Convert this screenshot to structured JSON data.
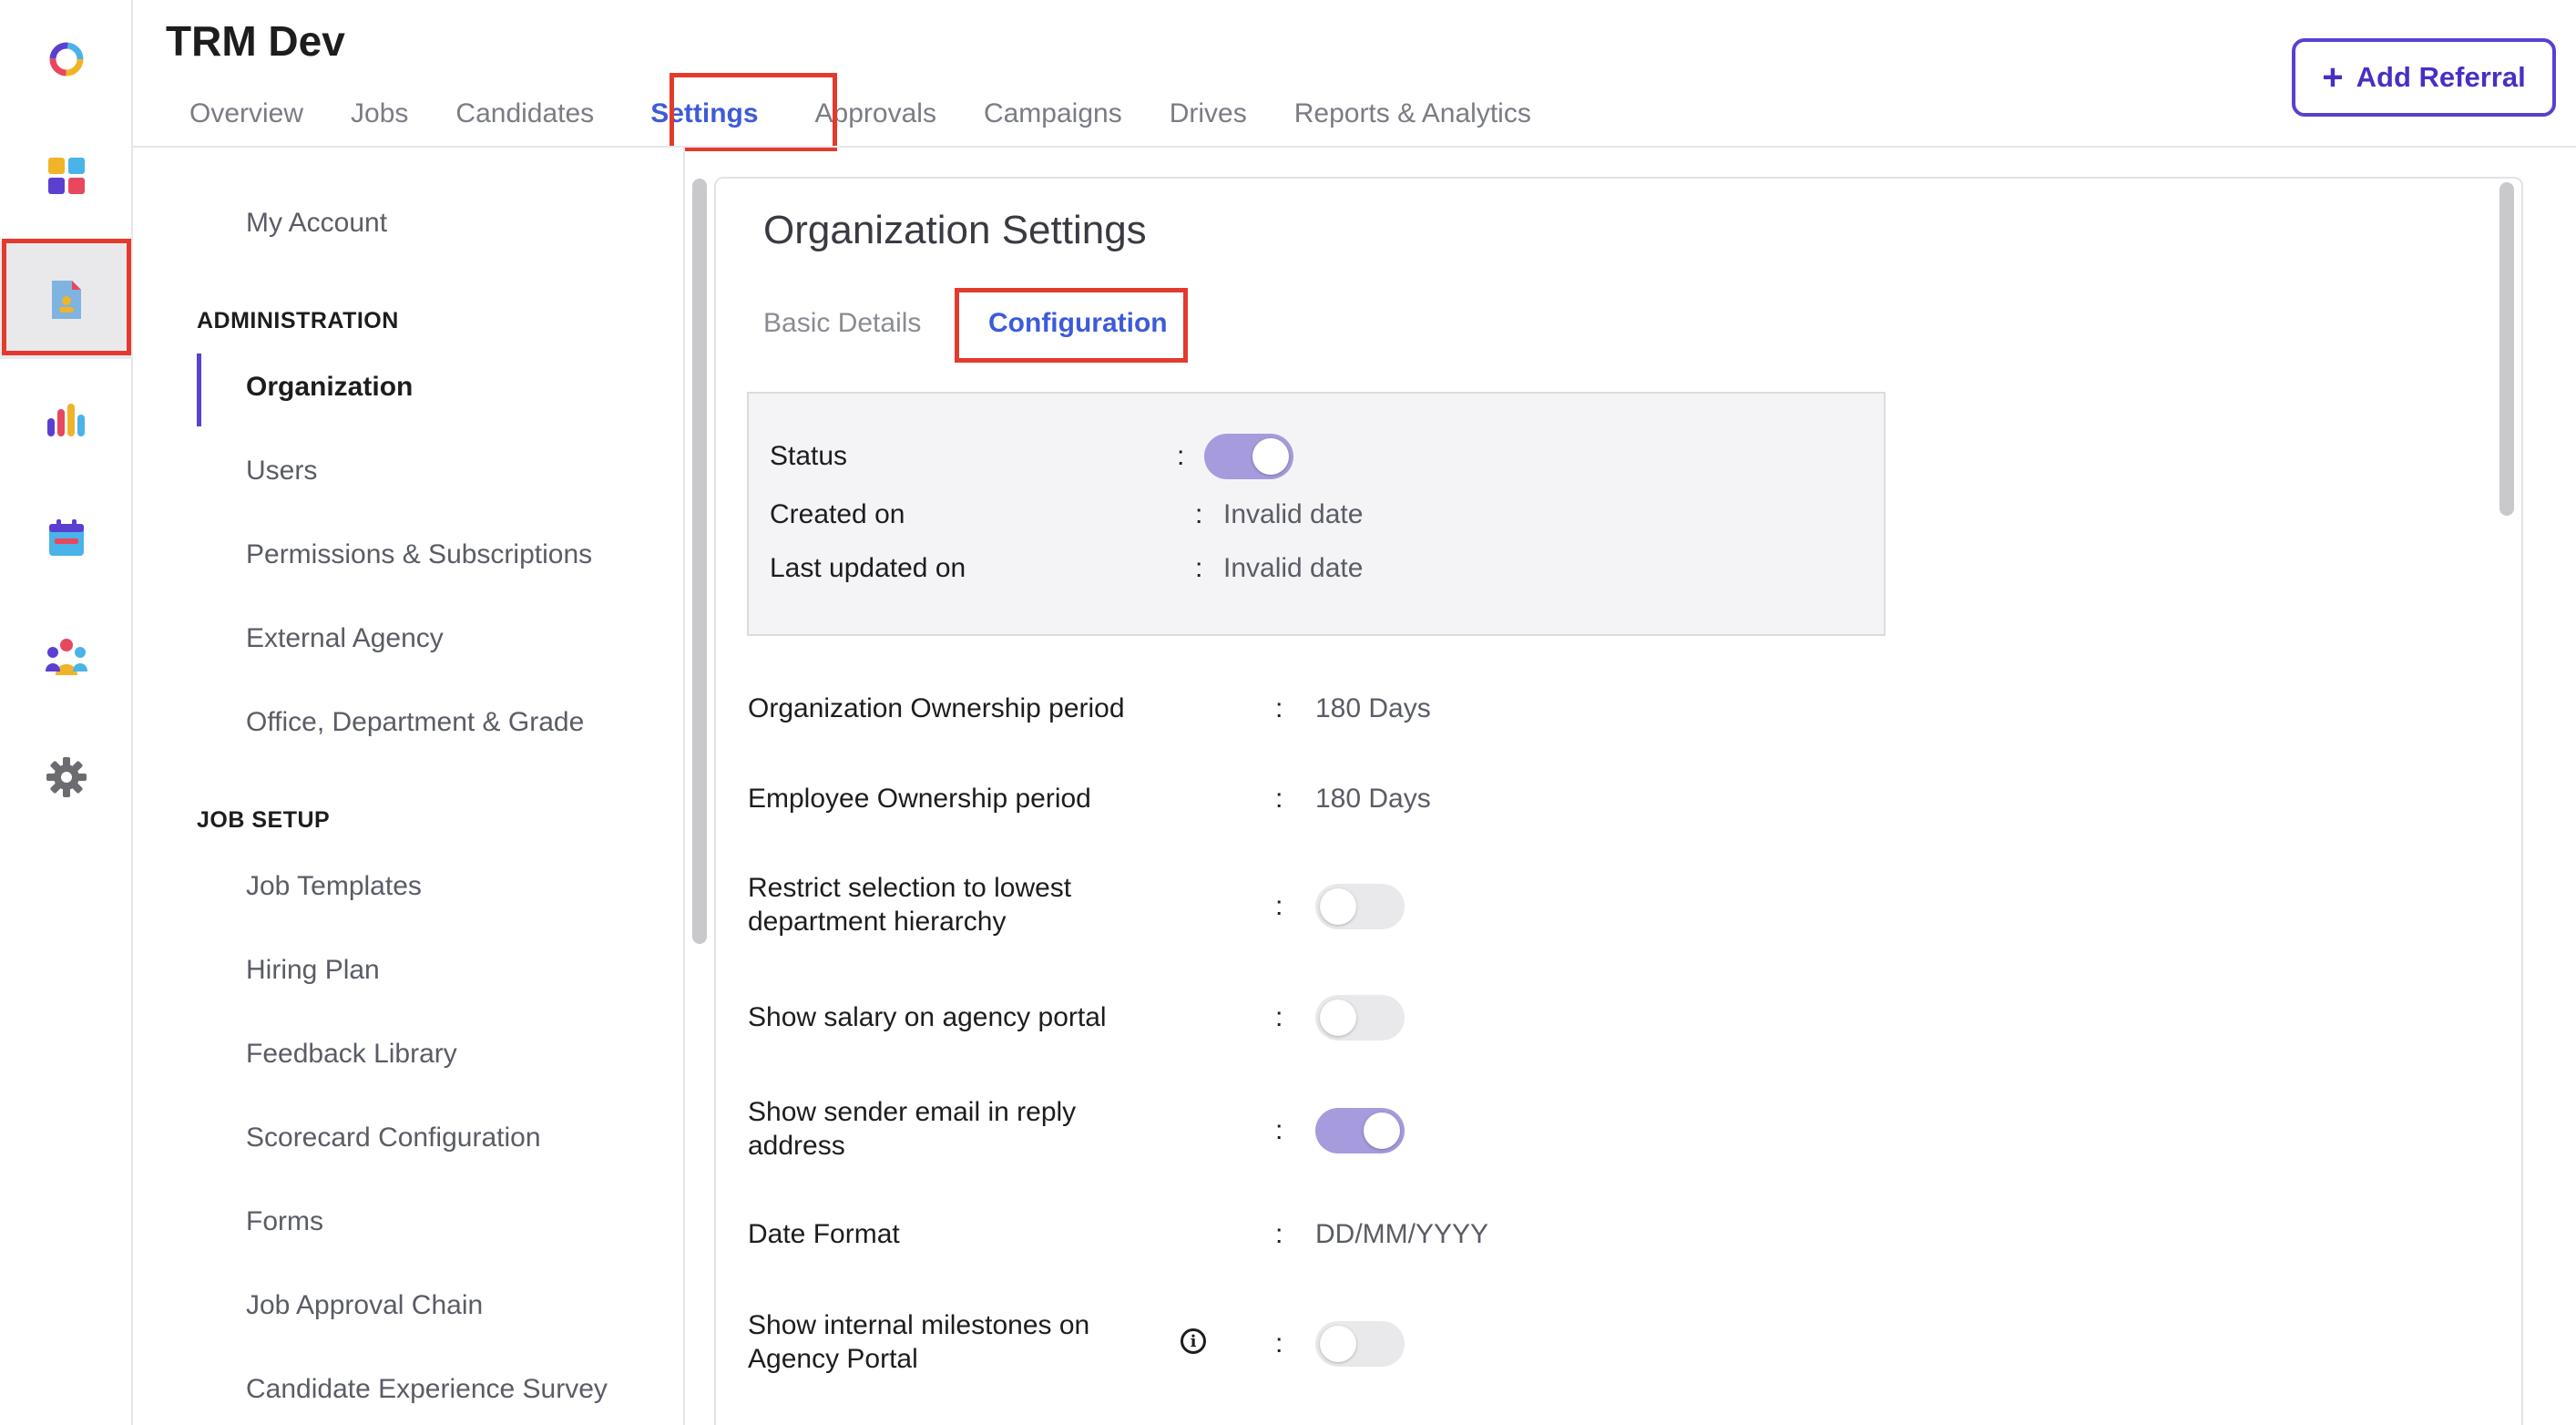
{
  "app": {
    "title": "TRM Dev",
    "add_referral_label": "Add Referral"
  },
  "tabs": [
    {
      "label": "Overview"
    },
    {
      "label": "Jobs"
    },
    {
      "label": "Candidates"
    },
    {
      "label": "Settings",
      "active": true
    },
    {
      "label": "Approvals"
    },
    {
      "label": "Campaigns"
    },
    {
      "label": "Drives"
    },
    {
      "label": "Reports & Analytics"
    }
  ],
  "rail": {
    "items": [
      "logo-icon",
      "dashboard-icon",
      "referral-document-icon",
      "analytics-icon",
      "calendar-icon",
      "team-icon",
      "settings-gear-icon"
    ],
    "active": "referral-document-icon"
  },
  "settings_nav": {
    "my_account": "My Account",
    "administration_heading": "ADMINISTRATION",
    "administration": [
      "Organization",
      "Users",
      "Permissions & Subscriptions",
      "External Agency",
      "Office, Department & Grade"
    ],
    "job_setup_heading": "JOB SETUP",
    "job_setup": [
      "Job Templates",
      "Hiring Plan",
      "Feedback Library",
      "Scorecard Configuration",
      "Forms",
      "Job Approval Chain",
      "Candidate Experience Survey"
    ],
    "active": "Organization"
  },
  "main": {
    "title": "Organization Settings",
    "subtabs": [
      "Basic Details",
      "Configuration"
    ],
    "active_subtab": "Configuration",
    "status_box": {
      "status_label": "Status",
      "status_on": true,
      "created_label": "Created on",
      "created_value": "Invalid date",
      "updated_label": "Last updated on",
      "updated_value": "Invalid date"
    },
    "config": {
      "org_ownership_label": "Organization Ownership period",
      "org_ownership_value": "180 Days",
      "emp_ownership_label": "Employee Ownership period",
      "emp_ownership_value": "180 Days",
      "restrict_label_1": "Restrict selection to lowest",
      "restrict_label_2": "department hierarchy",
      "restrict_on": false,
      "salary_label": "Show salary on agency portal",
      "salary_on": false,
      "sender_label_1": "Show sender email in reply",
      "sender_label_2": "address",
      "sender_on": true,
      "date_format_label": "Date Format",
      "date_format_value": "DD/MM/YYYY",
      "milestones_label_1": "Show internal milestones on",
      "milestones_label_2": "Agency Portal",
      "milestones_on": false
    },
    "colon": ":"
  },
  "colors": {
    "accent": "#5b3fd1",
    "link": "#3d5bd9",
    "toggle_on": "#a59bdd",
    "highlight": "#e23b2e"
  }
}
